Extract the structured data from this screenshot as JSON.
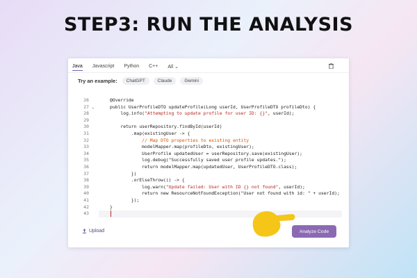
{
  "headline": "STEP3:  RUN THE ANALYSIS",
  "tabs": [
    {
      "label": "Java",
      "active": true
    },
    {
      "label": "Javascript",
      "active": false
    },
    {
      "label": "Python",
      "active": false
    },
    {
      "label": "C++",
      "active": false
    },
    {
      "label": "All ⌄",
      "active": false
    }
  ],
  "examples": {
    "label": "Try an example:",
    "chips": [
      "ChatGPT",
      "Claude",
      "Gemini"
    ]
  },
  "editor": {
    "lines": [
      {
        "n": "26",
        "code": "@Override"
      },
      {
        "n": "27",
        "fold": "⌄",
        "code": "public UserProfileDTO updateProfile(Long userId, UserProfileDTO profileDto) {"
      },
      {
        "n": "28",
        "segments": [
          {
            "t": "    log.info("
          },
          {
            "t": "\"Attempting to update profile for user ID: {}\"",
            "c": "str"
          },
          {
            "t": ", userId);"
          }
        ]
      },
      {
        "n": "29",
        "code": ""
      },
      {
        "n": "30",
        "code": "    return userRepository.findById(userId)"
      },
      {
        "n": "31",
        "code": "        .map(existingUser -> {"
      },
      {
        "n": "32",
        "segments": [
          {
            "t": "            "
          },
          {
            "t": "// Map DTO properties to existing entity",
            "c": "com"
          }
        ]
      },
      {
        "n": "33",
        "code": "            modelMapper.map(profileDto, existingUser);"
      },
      {
        "n": "34",
        "code": "            UserProfile updatedUser = userRepository.save(existingUser);"
      },
      {
        "n": "35",
        "code": "            log.debug(\"Successfully saved user profile updates.\");"
      },
      {
        "n": "36",
        "code": "            return modelMapper.map(updatedUser, UserProfileDTO.class);"
      },
      {
        "n": "37",
        "code": "        })"
      },
      {
        "n": "38",
        "code": "        .orElseThrow(() -> {"
      },
      {
        "n": "39",
        "segments": [
          {
            "t": "            log.warn("
          },
          {
            "t": "\"Update failed: User with ID {} not found\"",
            "c": "str"
          },
          {
            "t": ", userId);"
          }
        ]
      },
      {
        "n": "40",
        "code": "            return new ResourceNotFoundException(\"User not found with id: \" + userId);"
      },
      {
        "n": "41",
        "code": "        });"
      },
      {
        "n": "42",
        "code": "}"
      },
      {
        "n": "43",
        "code": ""
      }
    ]
  },
  "upload_label": "Upload",
  "analyze_label": "Analyze Code",
  "colors": {
    "accent": "#8c6ab3",
    "string": "#b3261e",
    "comment": "#d35400",
    "hand": "#f5c518"
  }
}
